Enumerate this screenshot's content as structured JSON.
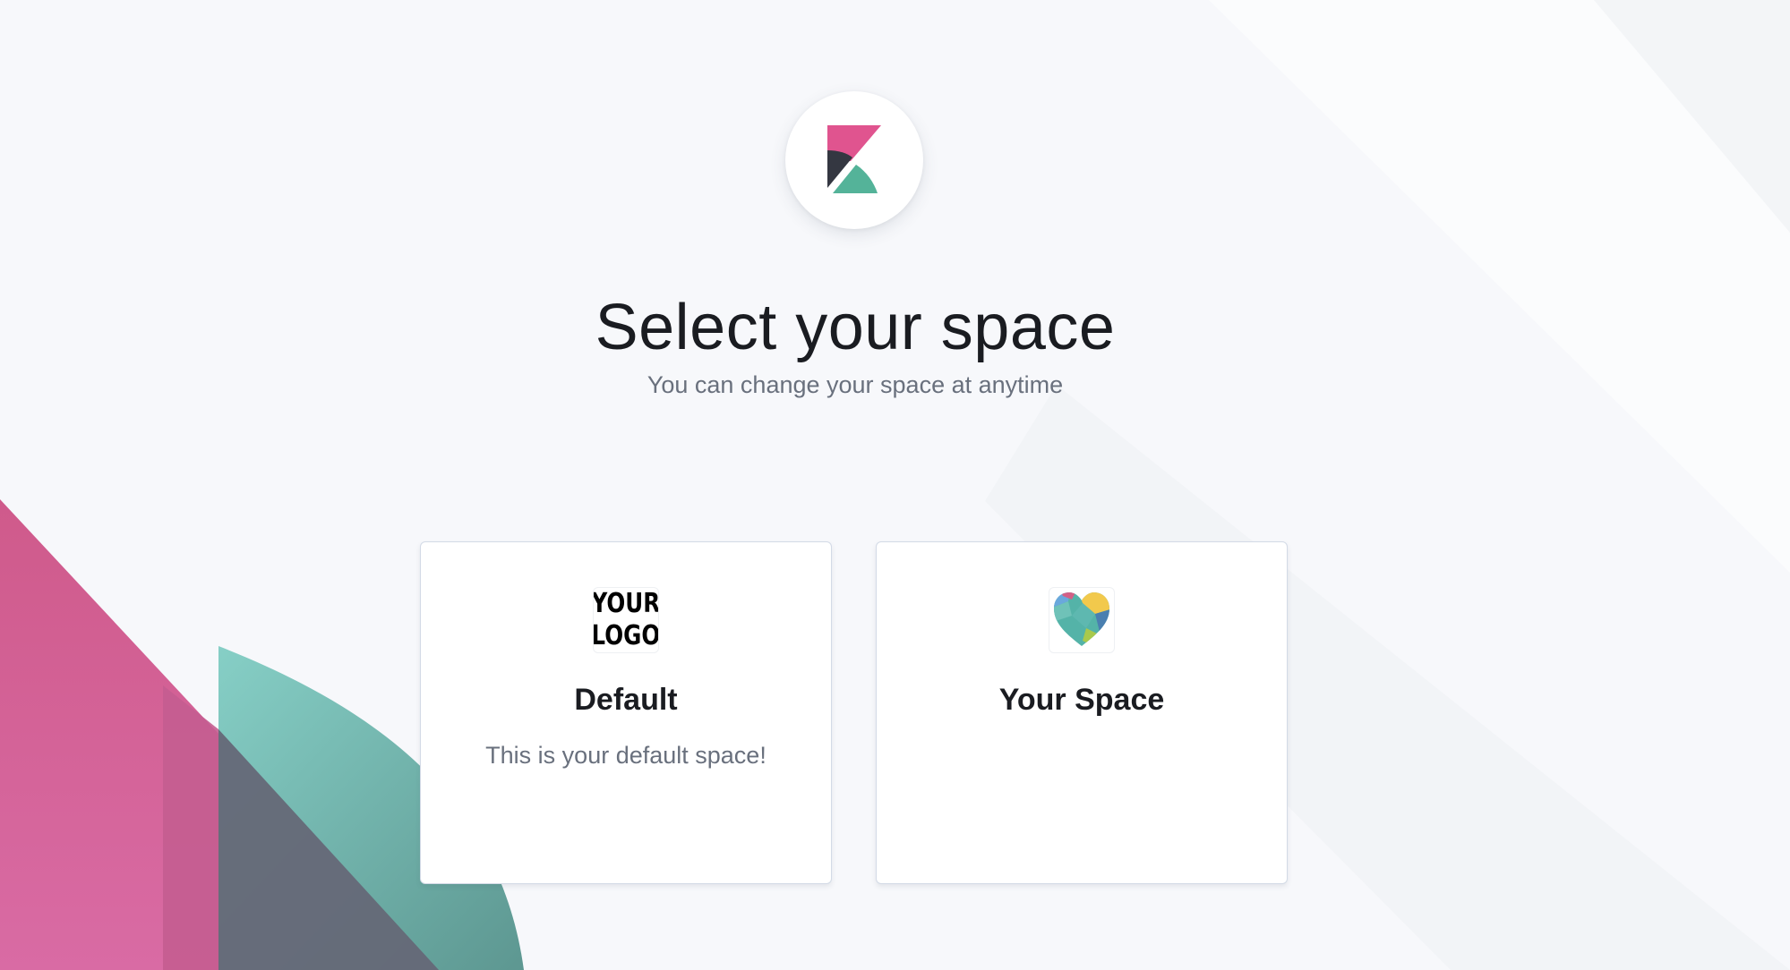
{
  "page": {
    "title": "Select your space",
    "subtitle": "You can change your space at anytime"
  },
  "brand": {
    "icon": "kibana-logo-icon",
    "colors": {
      "pink": "#e0548f",
      "dark": "#343741",
      "teal": "#54b399"
    }
  },
  "spaces": [
    {
      "name": "Default",
      "description": "This is your default space!",
      "avatar": {
        "type": "image",
        "text_line1": "YOUR",
        "text_line2": "LOGO"
      }
    },
    {
      "name": "Your Space",
      "description": "",
      "avatar": {
        "type": "image",
        "icon": "colorful-heart-icon"
      }
    }
  ]
}
